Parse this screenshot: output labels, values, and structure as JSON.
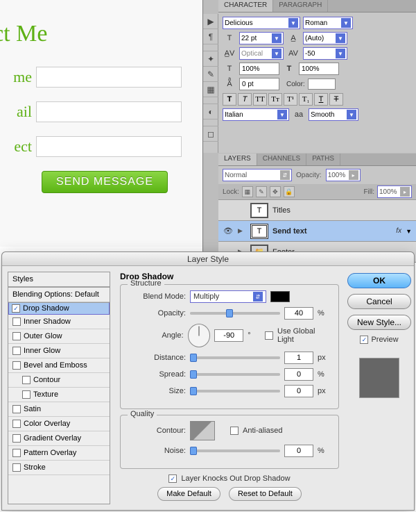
{
  "contact": {
    "title": "act Me",
    "labels": {
      "name": "me",
      "email": "ail",
      "subject": "ect"
    },
    "send": "SEND MESSAGE"
  },
  "char_panel": {
    "tabs": {
      "character": "CHARACTER",
      "paragraph": "PARAGRAPH"
    },
    "font": "Delicious",
    "style": "Roman",
    "size": "22 pt",
    "leading": "(Auto)",
    "kerning": "Optical",
    "tracking": "-50",
    "vscale": "100%",
    "hscale": "100%",
    "baseline": "0 pt",
    "color_label": "Color:",
    "lang": "Italian",
    "aa_icon": "aa",
    "aa": "Smooth"
  },
  "layers_panel": {
    "tabs": {
      "layers": "LAYERS",
      "channels": "CHANNELS",
      "paths": "PATHS"
    },
    "blend": "Normal",
    "opacity_label": "Opacity:",
    "opacity": "100%",
    "lock_label": "Lock:",
    "fill_label": "Fill:",
    "fill": "100%",
    "rows": {
      "titles": "Titles",
      "send": "Send text",
      "footer": "Footer"
    },
    "fx": "fx"
  },
  "dialog": {
    "title": "Layer Style",
    "styles": {
      "head": "Styles",
      "blending": "Blending Options: Default",
      "drop_shadow": "Drop Shadow",
      "inner_shadow": "Inner Shadow",
      "outer_glow": "Outer Glow",
      "inner_glow": "Inner Glow",
      "bevel": "Bevel and Emboss",
      "contour": "Contour",
      "texture": "Texture",
      "satin": "Satin",
      "color_overlay": "Color Overlay",
      "gradient_overlay": "Gradient Overlay",
      "pattern_overlay": "Pattern Overlay",
      "stroke": "Stroke"
    },
    "settings": {
      "heading": "Drop Shadow",
      "structure": "Structure",
      "blend_mode_label": "Blend Mode:",
      "blend_mode": "Multiply",
      "opacity_label": "Opacity:",
      "opacity": "40",
      "opacity_unit": "%",
      "angle_label": "Angle:",
      "angle": "-90",
      "angle_unit": "°",
      "use_global": "Use Global Light",
      "distance_label": "Distance:",
      "distance": "1",
      "distance_unit": "px",
      "spread_label": "Spread:",
      "spread": "0",
      "spread_unit": "%",
      "size_label": "Size:",
      "size": "0",
      "size_unit": "px",
      "quality": "Quality",
      "contour_label": "Contour:",
      "anti": "Anti-aliased",
      "noise_label": "Noise:",
      "noise": "0",
      "noise_unit": "%",
      "knockout": "Layer Knocks Out Drop Shadow",
      "make_default": "Make Default",
      "reset_default": "Reset to Default"
    },
    "actions": {
      "ok": "OK",
      "cancel": "Cancel",
      "new_style": "New Style...",
      "preview": "Preview"
    }
  }
}
